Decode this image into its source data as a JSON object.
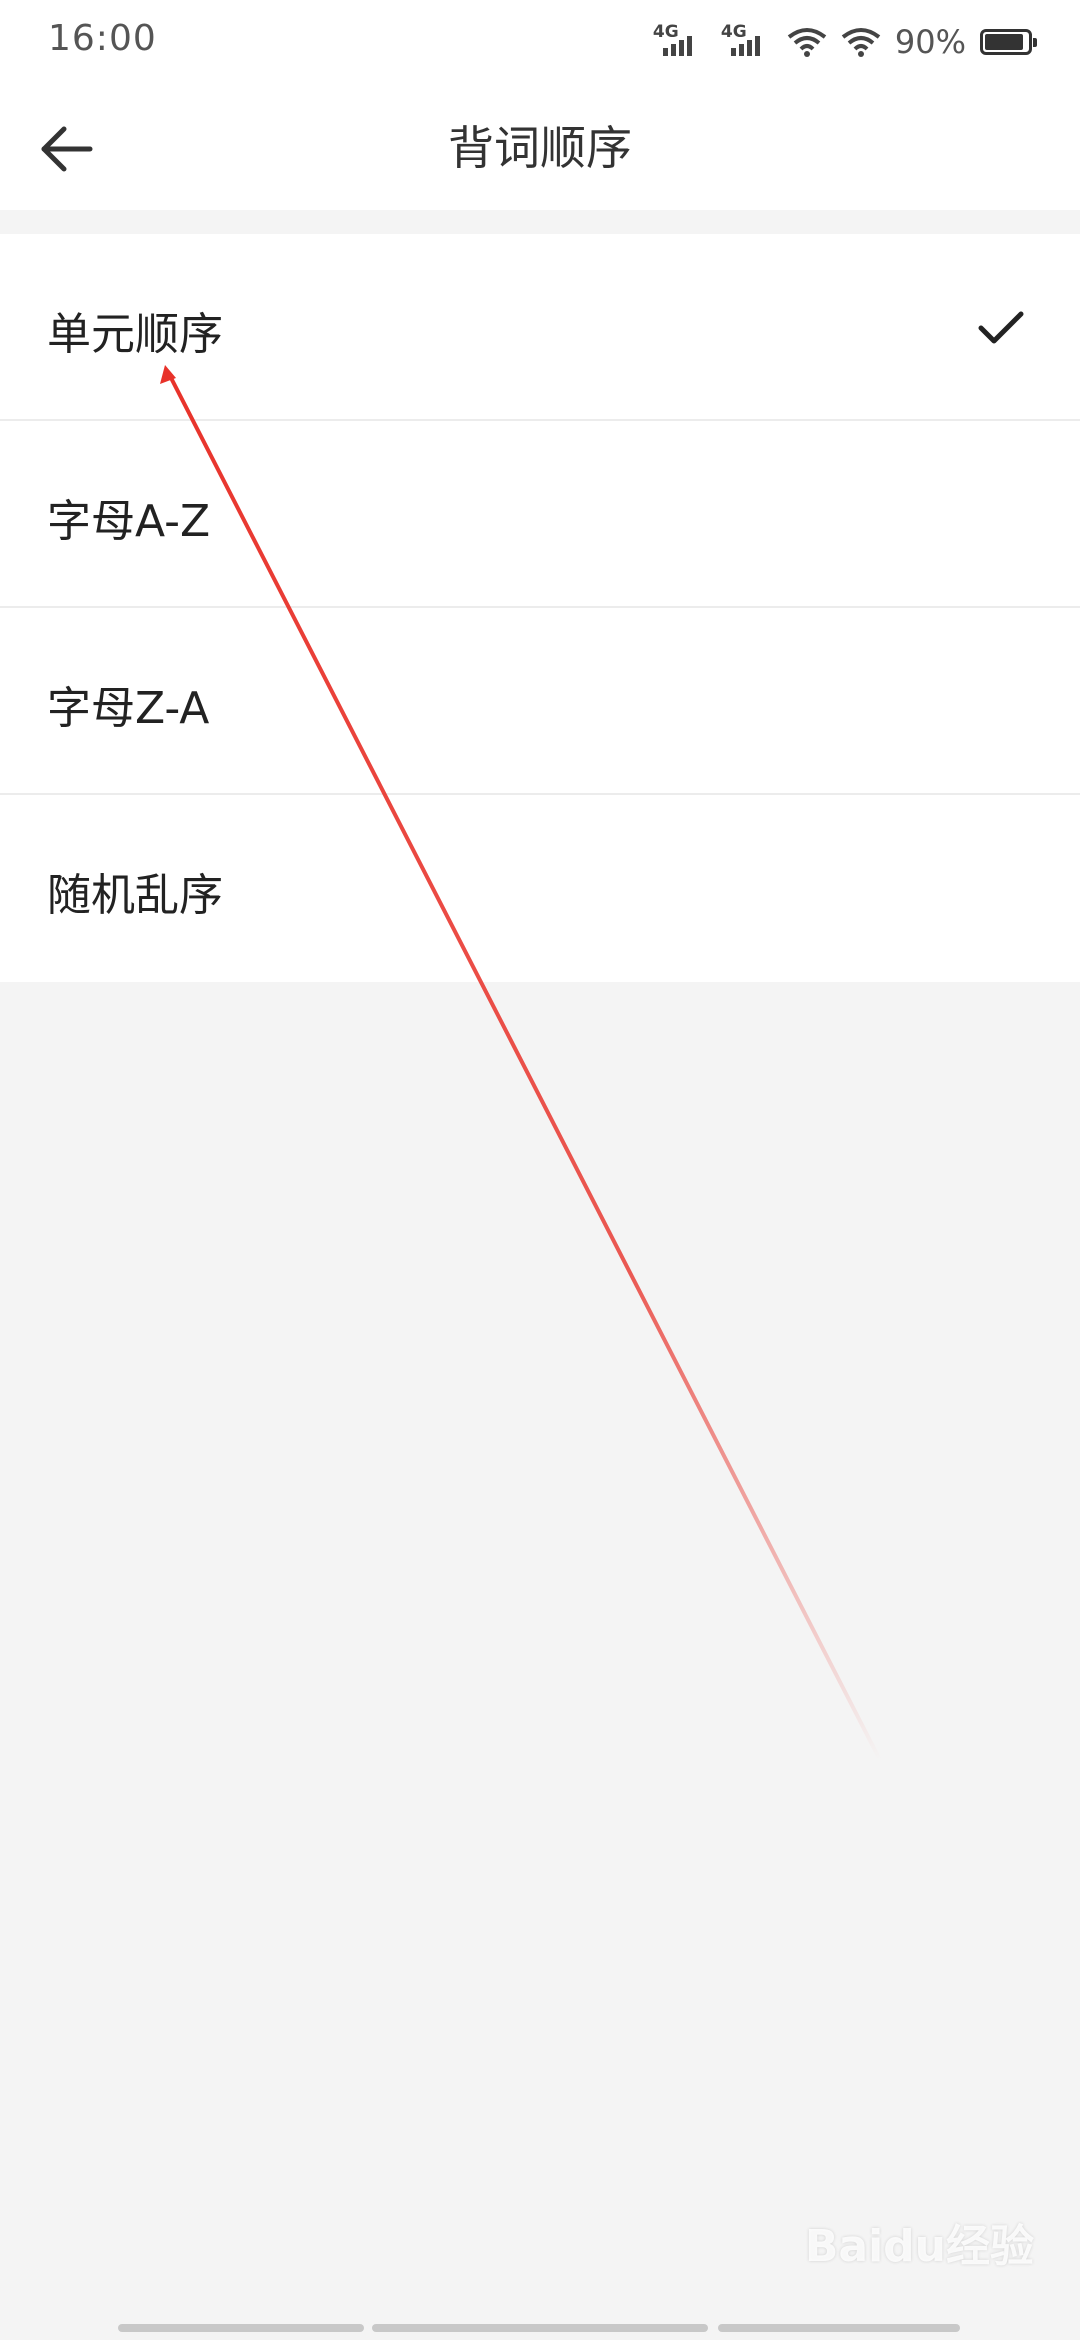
{
  "status_bar": {
    "time": "16:00",
    "network_1": "4G",
    "network_2": "4G",
    "battery_percent": "90%",
    "battery_level": 0.9,
    "icons": [
      "signal-icon",
      "signal-icon",
      "wifi-icon",
      "wifi-icon",
      "battery-icon"
    ]
  },
  "header": {
    "title": "背词顺序",
    "back_icon": "arrow-left-icon"
  },
  "options": [
    {
      "label": "单元顺序",
      "selected": true
    },
    {
      "label": "字母A-Z",
      "selected": false
    },
    {
      "label": "字母Z-A",
      "selected": false
    },
    {
      "label": "随机乱序",
      "selected": false
    }
  ],
  "colors": {
    "annotation_arrow": "#e8322a",
    "page_background": "#f4f4f4",
    "surface": "#ffffff"
  },
  "watermark": "Baidu经验"
}
